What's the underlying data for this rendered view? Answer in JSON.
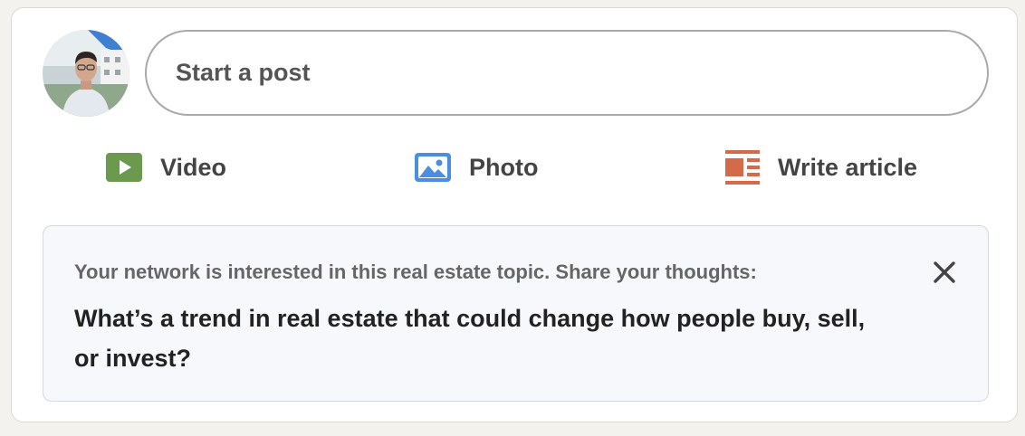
{
  "composer": {
    "placeholder": "Start a post"
  },
  "actions": [
    {
      "label": "Video",
      "icon": "video-icon",
      "color": "#6b9a4e"
    },
    {
      "label": "Photo",
      "icon": "photo-icon",
      "color": "#4a8ee0"
    },
    {
      "label": "Write article",
      "icon": "article-icon",
      "color": "#d46a4a"
    }
  ],
  "prompt": {
    "intro": "Your network is interested in this real estate topic. Share your thoughts:",
    "question": "What’s a trend in real estate that could change how people buy, sell, or invest?"
  }
}
